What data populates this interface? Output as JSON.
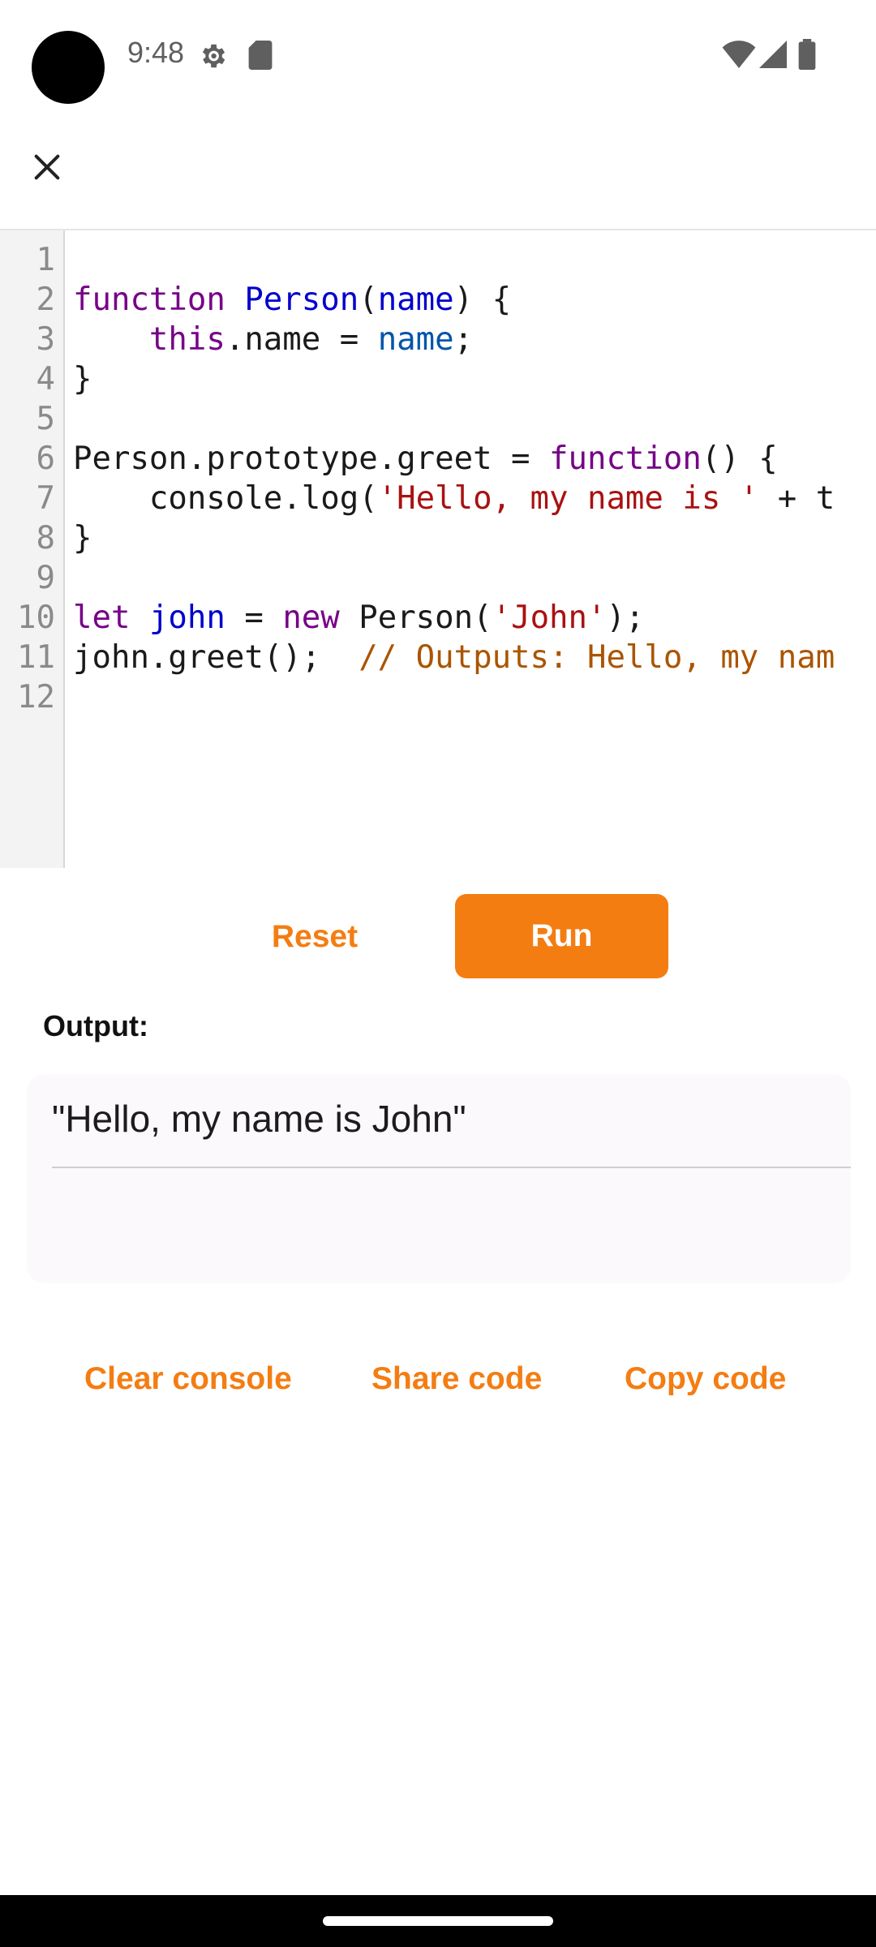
{
  "status_bar": {
    "time": "9:48",
    "icons": [
      "settings-icon",
      "sd-card-icon",
      "wifi-icon",
      "signal-icon",
      "battery-icon"
    ]
  },
  "toolbar": {
    "close_icon": "close-icon"
  },
  "editor": {
    "line_numbers": [
      "1",
      "2",
      "3",
      "4",
      "5",
      "6",
      "7",
      "8",
      "9",
      "10",
      "11",
      "12"
    ],
    "lines": [
      [],
      [
        {
          "t": "function",
          "c": "kw"
        },
        {
          "t": " ",
          "c": "plain"
        },
        {
          "t": "Person",
          "c": "def"
        },
        {
          "t": "(",
          "c": "plain"
        },
        {
          "t": "name",
          "c": "def"
        },
        {
          "t": ") {",
          "c": "plain"
        }
      ],
      [
        {
          "t": "    ",
          "c": "plain"
        },
        {
          "t": "this",
          "c": "kw"
        },
        {
          "t": ".name = ",
          "c": "plain"
        },
        {
          "t": "name",
          "c": "var"
        },
        {
          "t": ";",
          "c": "plain"
        }
      ],
      [
        {
          "t": "}",
          "c": "plain"
        }
      ],
      [],
      [
        {
          "t": "Person.prototype.greet = ",
          "c": "plain"
        },
        {
          "t": "function",
          "c": "kw"
        },
        {
          "t": "() {",
          "c": "plain"
        }
      ],
      [
        {
          "t": "    console.log(",
          "c": "plain"
        },
        {
          "t": "'Hello, my name is '",
          "c": "str"
        },
        {
          "t": " + t",
          "c": "plain"
        }
      ],
      [
        {
          "t": "}",
          "c": "plain"
        }
      ],
      [],
      [
        {
          "t": "let",
          "c": "kw"
        },
        {
          "t": " ",
          "c": "plain"
        },
        {
          "t": "john",
          "c": "def"
        },
        {
          "t": " = ",
          "c": "plain"
        },
        {
          "t": "new",
          "c": "kw"
        },
        {
          "t": " Person(",
          "c": "plain"
        },
        {
          "t": "'John'",
          "c": "str"
        },
        {
          "t": ");",
          "c": "plain"
        }
      ],
      [
        {
          "t": "john.greet();  ",
          "c": "plain"
        },
        {
          "t": "// Outputs: Hello, my nam",
          "c": "cmt"
        }
      ],
      []
    ]
  },
  "controls": {
    "reset_label": "Reset",
    "run_label": "Run"
  },
  "output": {
    "label": "Output:",
    "text": "\"Hello, my name is John\""
  },
  "actions": {
    "clear_console": "Clear console",
    "share_code": "Share code",
    "copy_code": "Copy code"
  },
  "colors": {
    "accent": "#f47d12",
    "keyword": "#770088",
    "definition": "#0000cc",
    "variable": "#0055aa",
    "string": "#aa1111",
    "comment": "#aa5500"
  }
}
